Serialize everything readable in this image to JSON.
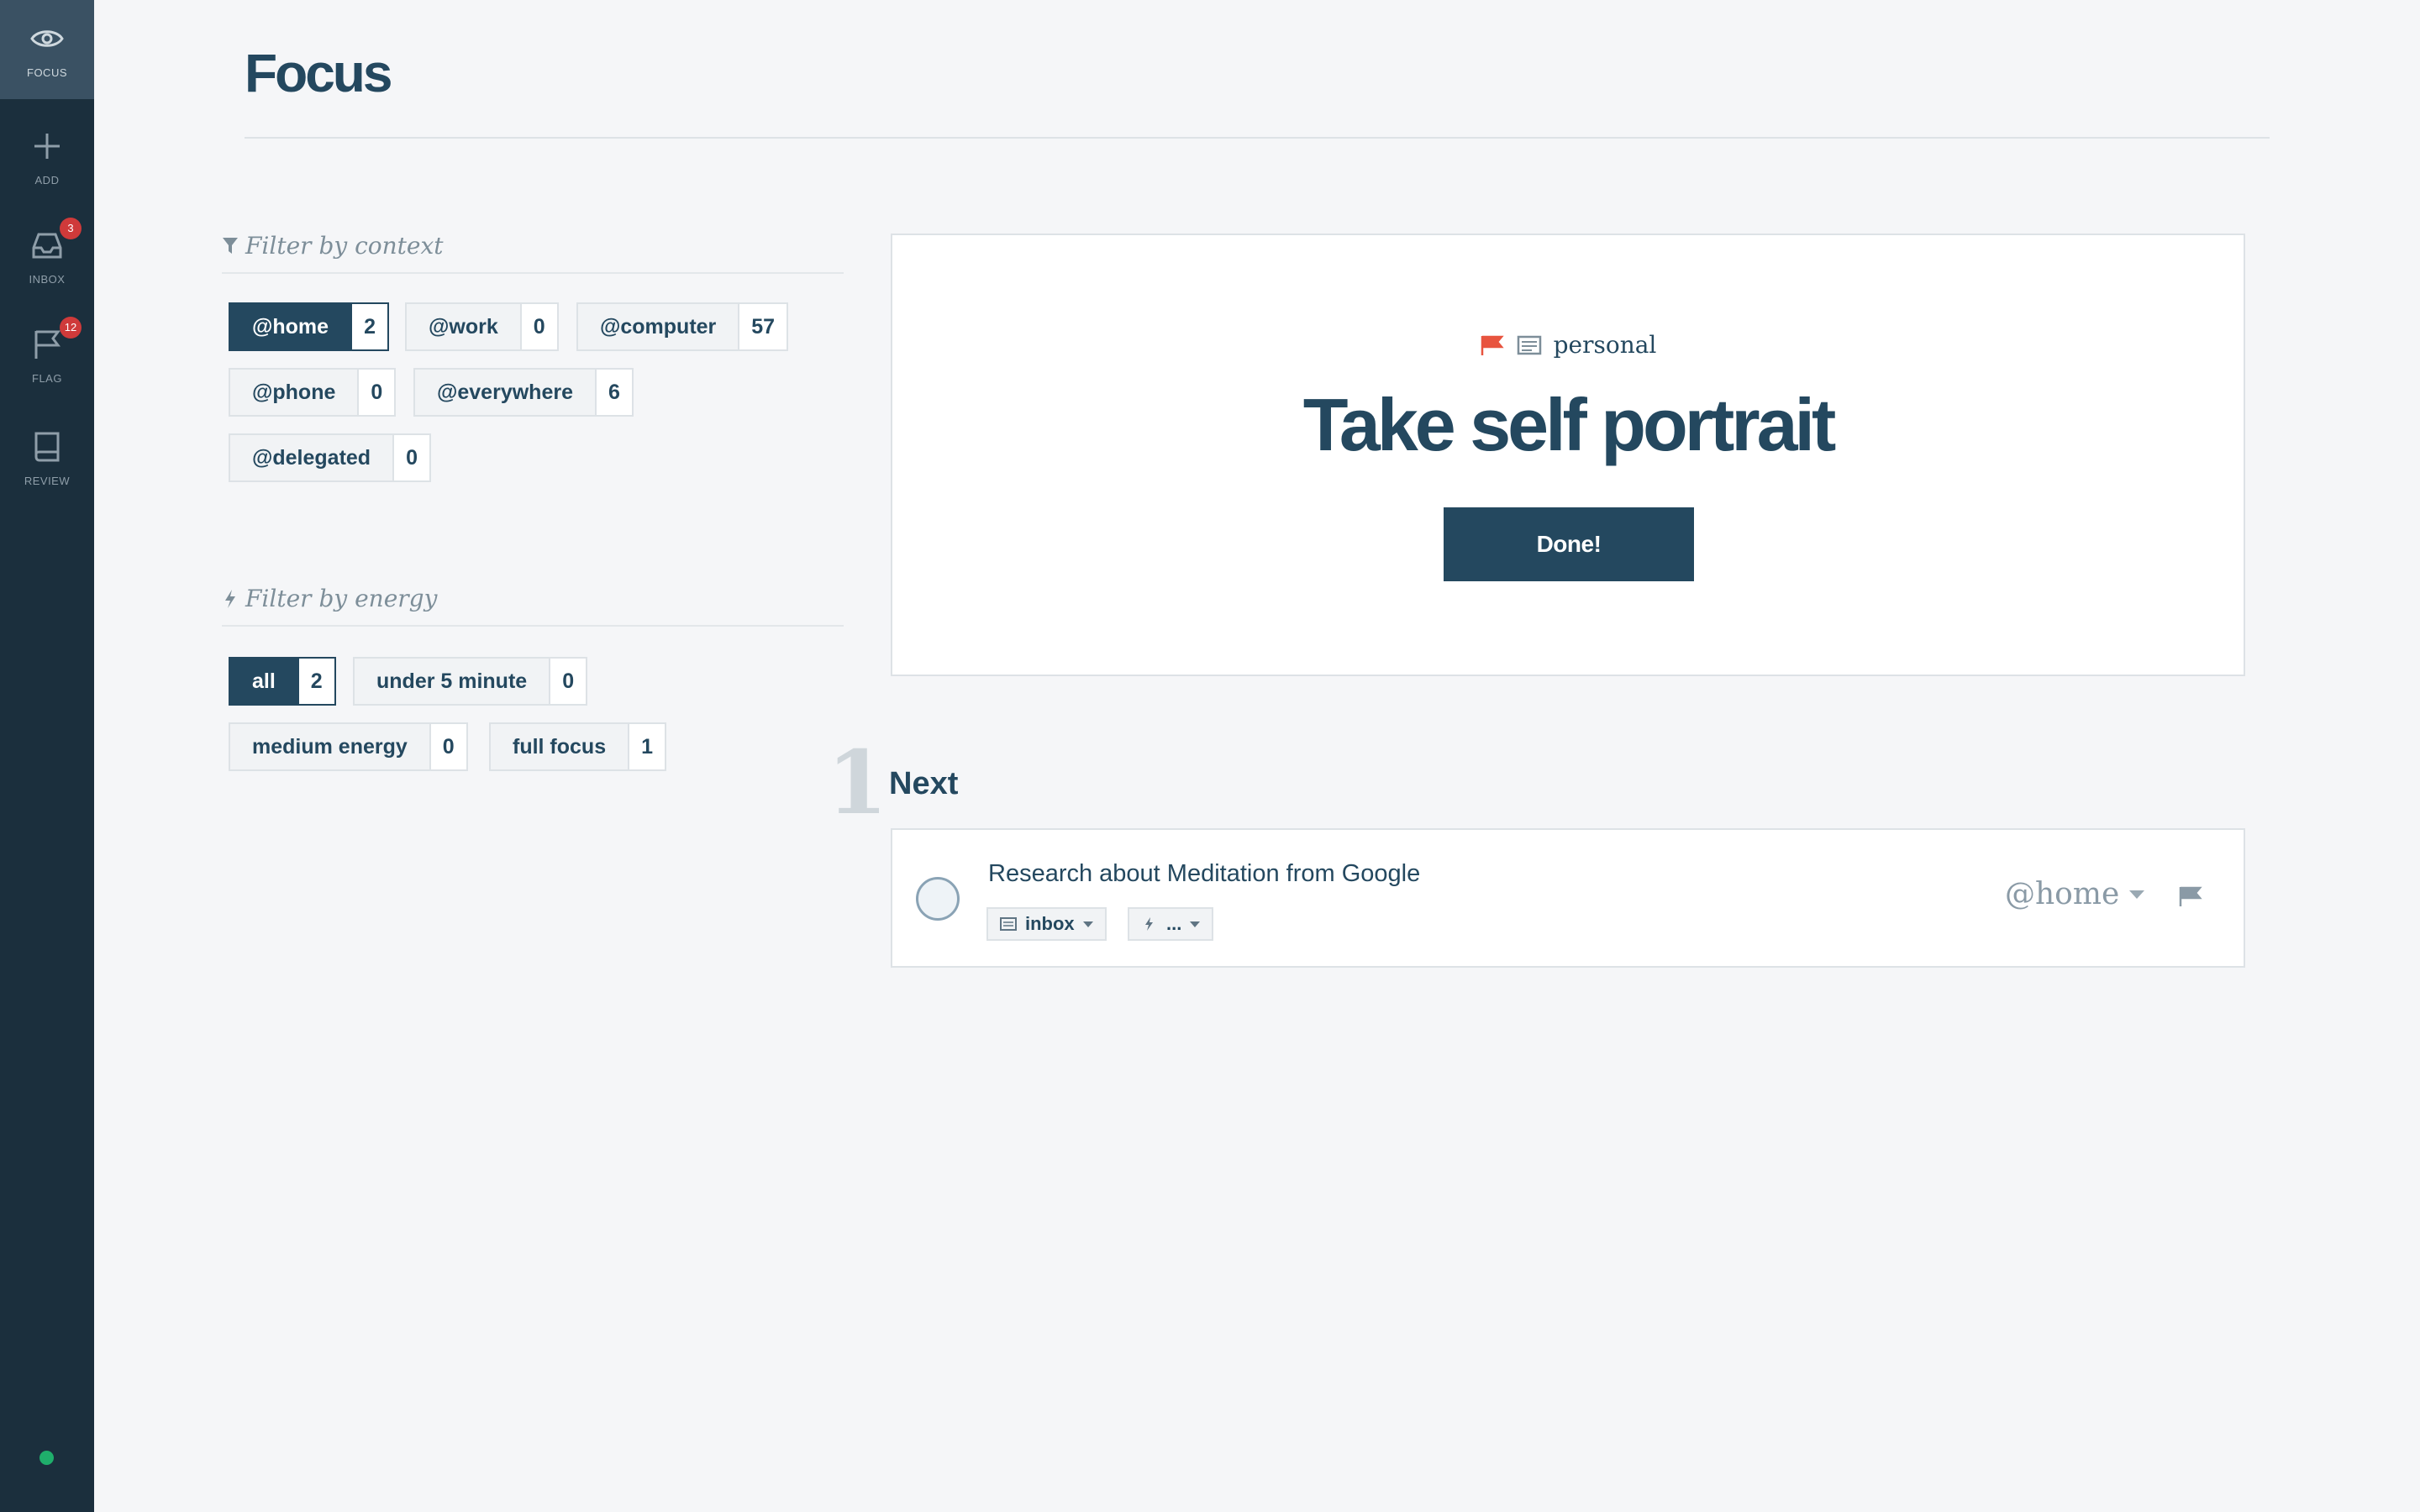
{
  "sidebar": {
    "items": [
      {
        "label": "FOCUS",
        "icon": "eye-icon"
      },
      {
        "label": "ADD",
        "icon": "plus-icon"
      },
      {
        "label": "INBOX",
        "icon": "inbox-icon",
        "badge": "3"
      },
      {
        "label": "FLAG",
        "icon": "flag-icon",
        "badge": "12"
      },
      {
        "label": "REVIEW",
        "icon": "book-icon"
      }
    ],
    "status_color": "#1fae6b"
  },
  "header": {
    "title": "Focus"
  },
  "context_filter": {
    "heading": "Filter by context",
    "icon": "funnel-icon",
    "chips": [
      {
        "label": "@home",
        "count": "2",
        "active": true
      },
      {
        "label": "@work",
        "count": "0"
      },
      {
        "label": "@computer",
        "count": "57"
      },
      {
        "label": "@phone",
        "count": "0"
      },
      {
        "label": "@everywhere",
        "count": "6"
      },
      {
        "label": "@delegated",
        "count": "0"
      }
    ]
  },
  "energy_filter": {
    "heading": "Filter by energy",
    "icon": "bolt-icon",
    "chips": [
      {
        "label": "all",
        "count": "2",
        "active": true
      },
      {
        "label": "under 5 minute",
        "count": "0"
      },
      {
        "label": "medium energy",
        "count": "0"
      },
      {
        "label": "full focus",
        "count": "1"
      }
    ]
  },
  "focus_card": {
    "project": "personal",
    "flag_color": "#e8543f",
    "title": "Take self portrait",
    "done_label": "Done!"
  },
  "next": {
    "count": "1",
    "label": "Next",
    "tasks": [
      {
        "title": "Research about Meditation from Google",
        "project": "inbox",
        "energy": "...",
        "context": "@home"
      }
    ]
  },
  "colors": {
    "accent": "#24485f",
    "sidebar": "#1b2f3d",
    "badge": "#cf3a3a"
  }
}
